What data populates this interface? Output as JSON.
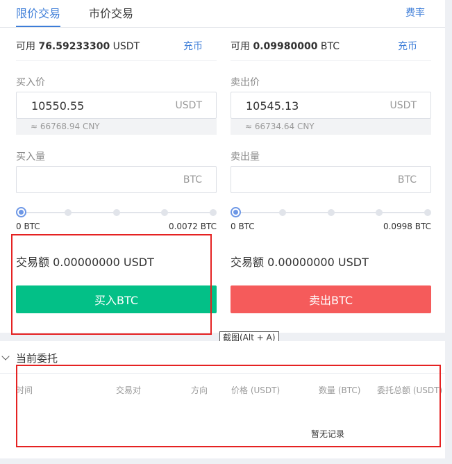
{
  "tabs": [
    {
      "label": "限价交易",
      "active": true
    },
    {
      "label": "市价交易",
      "active": false
    }
  ],
  "fee_link": "费率",
  "buy": {
    "available_prefix": "可用",
    "available_amount": "76.59233300",
    "available_unit": "USDT",
    "charge_link": "充币",
    "price_label": "买入价",
    "price_value": "10550.55",
    "price_unit": "USDT",
    "cny_hint": "≈ 66768.94 CNY",
    "amount_label": "买入量",
    "amount_value": "",
    "amount_unit": "BTC",
    "slider_level": 0,
    "range_min": "0 BTC",
    "range_max": "0.0072 BTC",
    "total_text": "交易额 0.00000000 USDT",
    "button_label": "买入BTC"
  },
  "sell": {
    "available_prefix": "可用",
    "available_amount": "0.09980000",
    "available_unit": "BTC",
    "charge_link": "充币",
    "price_label": "卖出价",
    "price_value": "10545.13",
    "price_unit": "USDT",
    "cny_hint": "≈ 66734.64 CNY",
    "amount_label": "卖出量",
    "amount_value": "",
    "amount_unit": "BTC",
    "slider_level": 0,
    "range_min": "0 BTC",
    "range_max": "0.0998 BTC",
    "total_text": "交易额 0.00000000 USDT",
    "button_label": "卖出BTC"
  },
  "tooltip": "截图(Alt + A)",
  "orders": {
    "title": "当前委托",
    "columns": [
      "时间",
      "交易对",
      "方向",
      "价格 (USDT)",
      "数量 (BTC)",
      "委托总额 (USDT)"
    ],
    "empty_text": "暂无记录"
  },
  "colors": {
    "accent": "#3d7dd8",
    "buy": "#03c087",
    "sell": "#f55b5b",
    "highlight_box": "#e52222"
  }
}
